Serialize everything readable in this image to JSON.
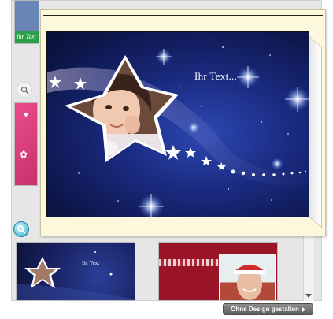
{
  "thumbnails": {
    "top_caption": "Ihr Text",
    "star_caption": "Ihr Text"
  },
  "popup": {
    "card_caption": "Ihr Text..."
  },
  "bottom_bar": {
    "design_button_label": "Ohne Design gestalten"
  },
  "icons": {
    "zoom": "magnifier-icon",
    "zoom_active": "zoom-active-icon",
    "arrow": "triangle-right-icon",
    "scroll_down": "scroll-down-arrow-icon"
  },
  "colors": {
    "popup_background": "#fbf8dc",
    "card_navy": "#1a2a80",
    "button_gray": "#6e6e6e",
    "christmas_red": "#9a1428"
  }
}
